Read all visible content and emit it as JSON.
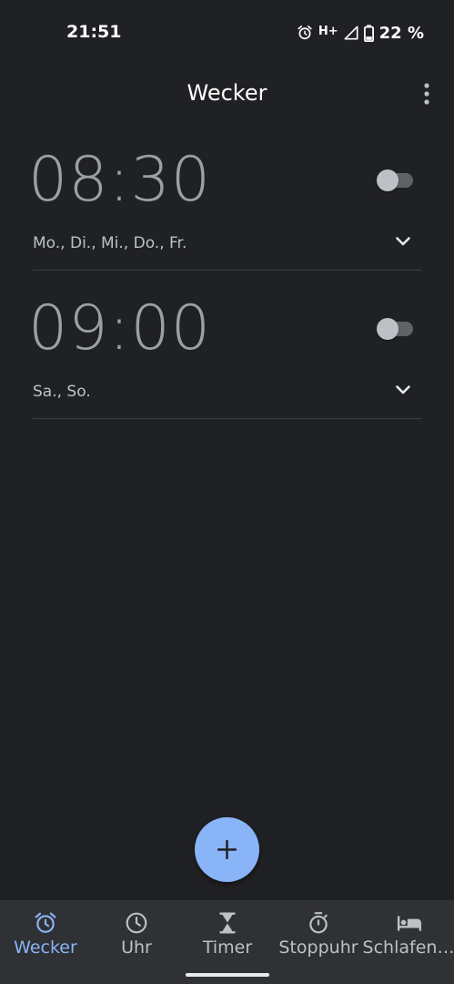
{
  "status_bar": {
    "time": "21:51",
    "network": "H+",
    "battery": "22 %"
  },
  "app_bar": {
    "title": "Wecker"
  },
  "alarms": [
    {
      "time": "08:30",
      "days": "Mo., Di., Mi., Do., Fr.",
      "enabled": false
    },
    {
      "time": "09:00",
      "days": "Sa., So.",
      "enabled": false
    }
  ],
  "bottom_nav": {
    "items": [
      {
        "label": "Wecker",
        "icon": "alarm-icon",
        "active": true
      },
      {
        "label": "Uhr",
        "icon": "clock-icon",
        "active": false
      },
      {
        "label": "Timer",
        "icon": "hourglass-icon",
        "active": false
      },
      {
        "label": "Stoppuhr",
        "icon": "stopwatch-icon",
        "active": false
      },
      {
        "label": "Schlafen…",
        "icon": "bed-icon",
        "active": false
      }
    ]
  },
  "colors": {
    "background": "#202124",
    "nav_background": "#303134",
    "accent": "#8ab4f8",
    "alarm_time": "#9aa0a6"
  }
}
